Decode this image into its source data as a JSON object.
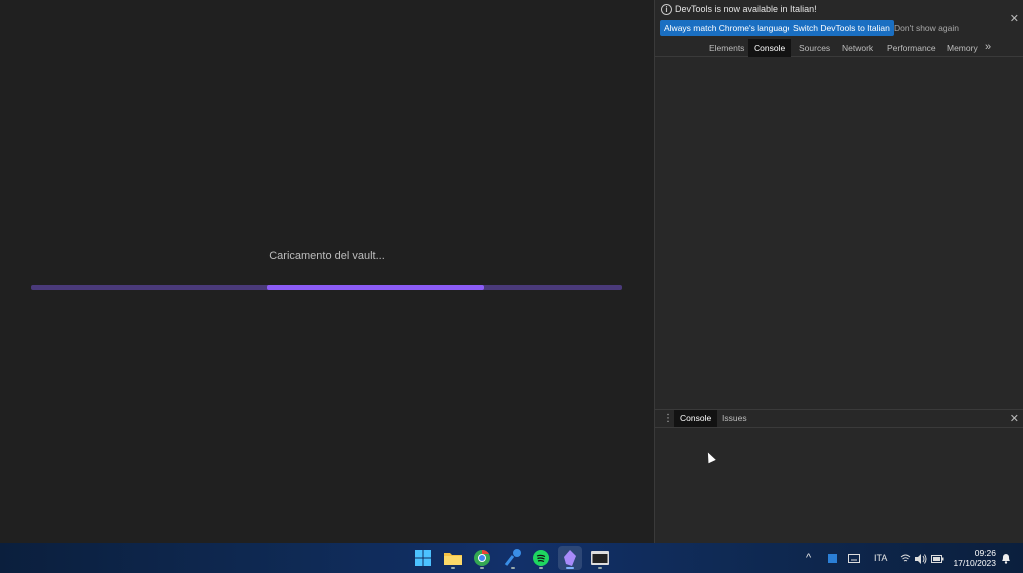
{
  "app": {
    "loading_text": "Caricamento del vault...",
    "progress": {
      "start": 0.4,
      "end": 0.766
    }
  },
  "devtools": {
    "infobar": {
      "message": "DevTools is now available in Italian!",
      "btn_match": "Always match Chrome's language",
      "btn_switch": "Switch DevTools to Italian",
      "btn_dont": "Don't show again",
      "close": "✕",
      "info_glyph": "i"
    },
    "tabs": [
      "Elements",
      "Console",
      "Sources",
      "Network",
      "Performance",
      "Memory"
    ],
    "tab_more": "»",
    "active_tab": "Console",
    "drawer": {
      "menu": "⋮",
      "tabs": [
        "Console",
        "Issues"
      ],
      "active_tab": "Console",
      "close": "✕"
    }
  },
  "taskbar": {
    "apps": [
      "windows-start-icon",
      "file-explorer-icon",
      "chrome-icon",
      "steam-icon",
      "spotify-icon",
      "obsidian-icon",
      "terminal-icon"
    ],
    "tray": {
      "chevron": "^",
      "language": "ITA",
      "time": "09:26",
      "date": "17/10/2023"
    }
  },
  "colors": {
    "accent": "#8b5cf6",
    "track": "#4a3a7a",
    "devtools_button": "#1a6fc2"
  }
}
